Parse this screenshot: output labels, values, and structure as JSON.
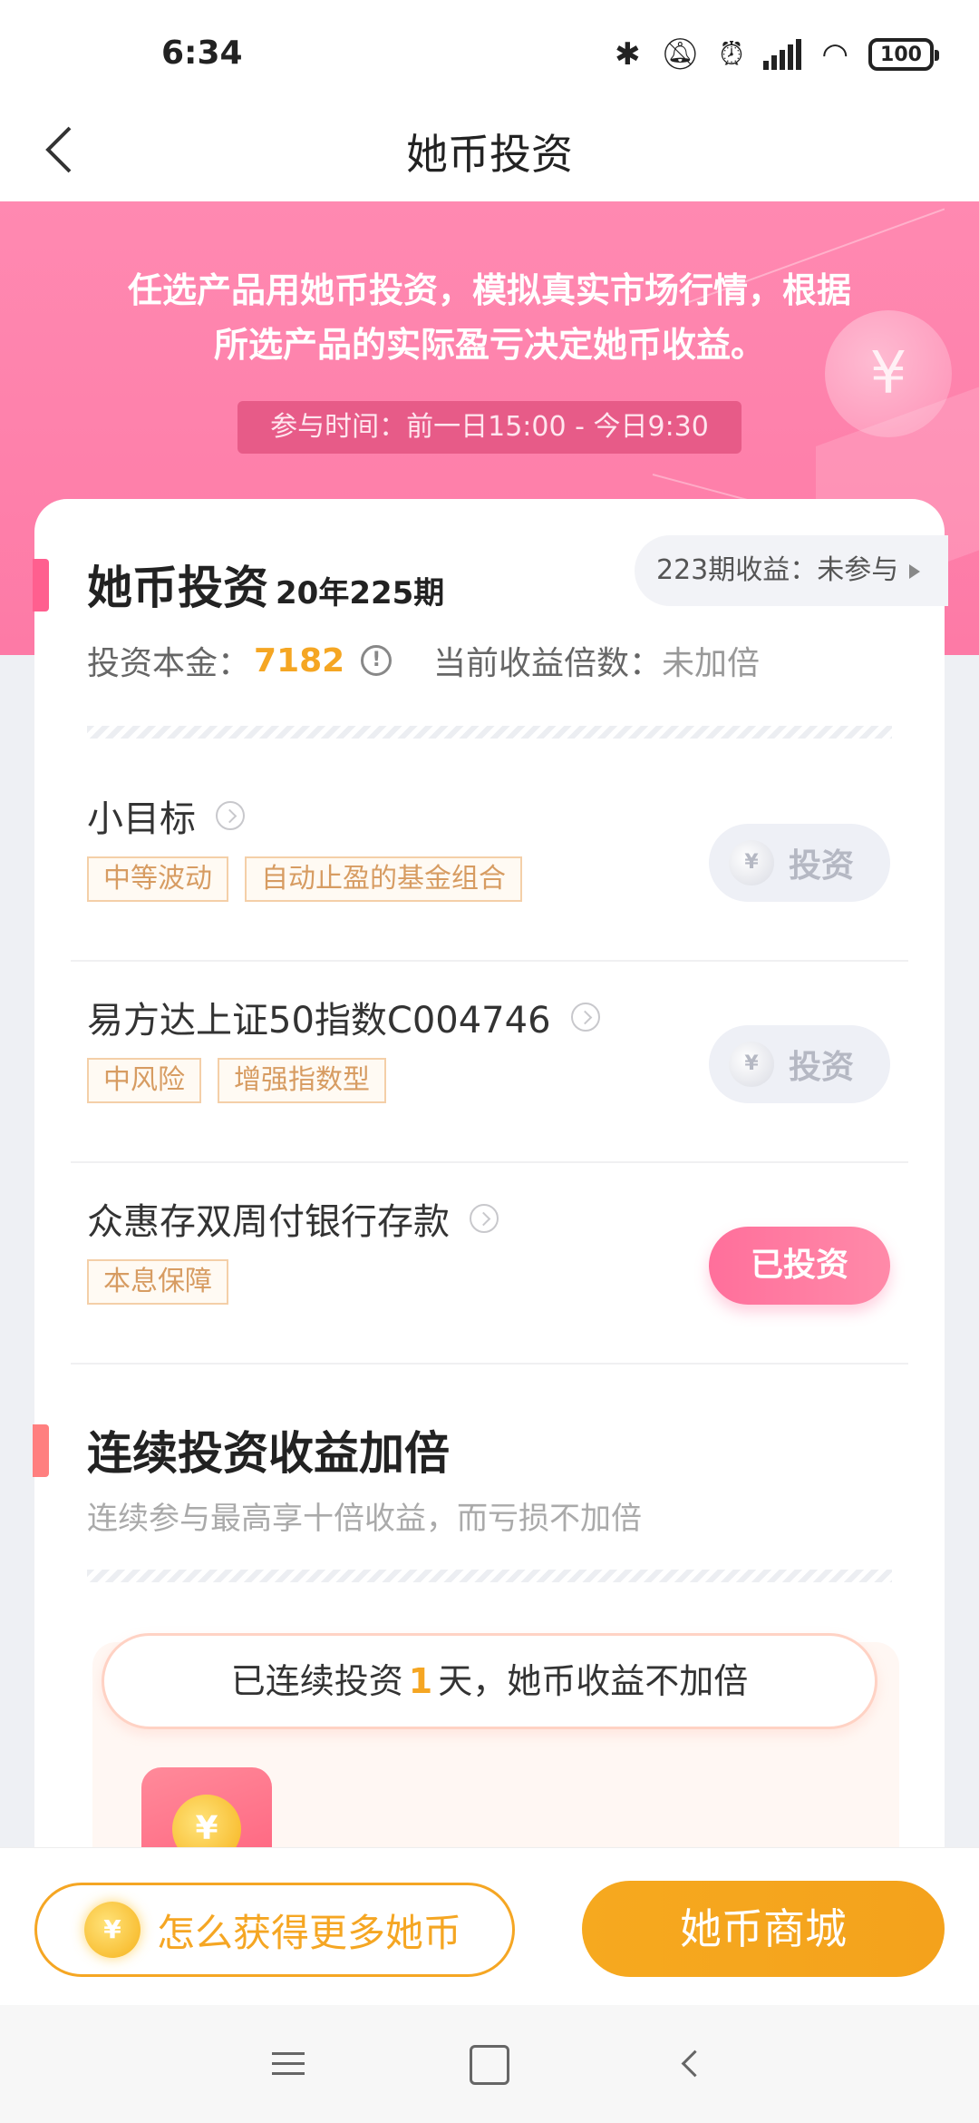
{
  "status_bar": {
    "time": "6:34",
    "battery": "100"
  },
  "nav": {
    "title": "她币投资"
  },
  "banner": {
    "description_line1": "任选产品用她币投资，模拟真实市场行情，根据",
    "description_line2": "所选产品的实际盈亏决定她币收益。",
    "time_window": "参与时间：前一日15:00 - 今日9:30"
  },
  "investment": {
    "title": "她币投资",
    "period": "20年225期",
    "previous_result": "223期收益：未参与",
    "principal_label": "投资本金：",
    "principal_value": "7182",
    "multiplier_label": "当前收益倍数：",
    "multiplier_value": "未加倍"
  },
  "products": [
    {
      "name": "小目标",
      "tags": [
        "中等波动",
        "自动止盈的基金组合"
      ],
      "action": "投资",
      "invested": false
    },
    {
      "name": "易方达上证50指数C004746",
      "tags": [
        "中风险",
        "增强指数型"
      ],
      "action": "投资",
      "invested": false
    },
    {
      "name": "众惠存双周付银行存款",
      "tags": [
        "本息保障"
      ],
      "action": "已投资",
      "invested": true
    }
  ],
  "streak": {
    "title": "连续投资收益加倍",
    "description": "连续参与最高享十倍收益，而亏损不加倍",
    "status_prefix": "已连续投资",
    "days": "1",
    "status_suffix": "天，她币收益不加倍"
  },
  "bottom": {
    "earn_label": "怎么获得更多她币",
    "mall_label": "她币商城"
  },
  "coin_symbol": "¥",
  "colors": {
    "pink": "#ff7aa6",
    "orange": "#f5a623"
  }
}
